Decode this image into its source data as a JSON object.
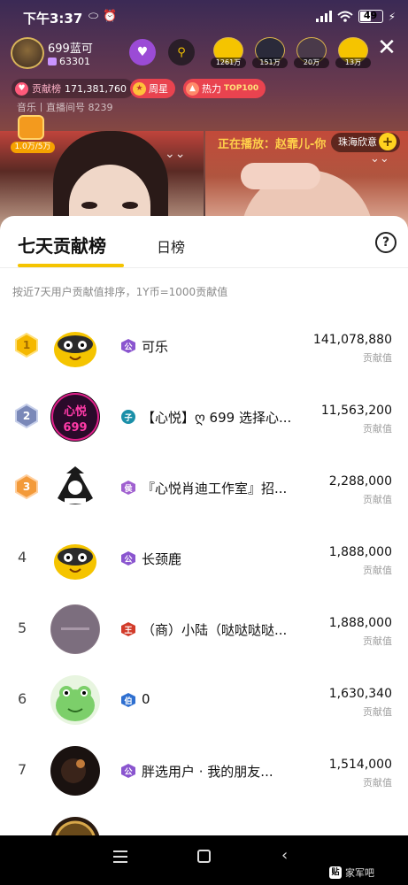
{
  "status_bar": {
    "time": "下午3:37",
    "battery": "49"
  },
  "anchor": {
    "name": "699蓝可",
    "fans": "63301"
  },
  "viewers": [
    "1261万",
    "151万",
    "20万",
    "13万"
  ],
  "contribution": {
    "label": "贡献榜",
    "value": "171,381,760"
  },
  "weekly_star": "周星",
  "hot": {
    "label": "热力",
    "top": "TOP100"
  },
  "room_meta": "音乐丨直播间号  8239",
  "treasure_text": "1.0万/5万",
  "now_playing": "正在播放：赵霏儿-你",
  "pearl_label": "珠海欣意",
  "sheet": {
    "tab_active": "七天贡献榜",
    "tab_day": "日榜",
    "help": "?",
    "description": "按近7天用户贡献值排序，1Y币=1000贡献值",
    "score_unit": "贡献值"
  },
  "ranking": [
    {
      "rank": "1",
      "badge": "公",
      "name": "可乐",
      "score": "141,078,880",
      "badge_color": "#8a55cf",
      "badge_shape": "hex"
    },
    {
      "rank": "2",
      "badge": "子",
      "name": "【心悦】ღ 699 选择心...",
      "score": "11,563,200",
      "badge_color": "#1a8fa8",
      "badge_shape": "circle"
    },
    {
      "rank": "3",
      "badge": "侯",
      "name": "『心悦肖迪工作室』招...",
      "score": "2,288,000",
      "badge_color": "#a060d0",
      "badge_shape": "hex"
    },
    {
      "rank": "4",
      "badge": "公",
      "name": "长颈鹿",
      "score": "1,888,000",
      "badge_color": "#8a55cf",
      "badge_shape": "hex"
    },
    {
      "rank": "5",
      "badge": "王",
      "name": "（商）小陆（哒哒哒哒...",
      "score": "1,888,000",
      "badge_color": "#d23b2a",
      "badge_shape": "hex"
    },
    {
      "rank": "6",
      "badge": "伯",
      "name": "0",
      "score": "1,630,340",
      "badge_color": "#2e6fd0",
      "badge_shape": "hex"
    },
    {
      "rank": "7",
      "badge": "公",
      "name": "胖选用户 · 我的朋友...",
      "score": "1,514,000",
      "badge_color": "#8a55cf",
      "badge_shape": "hex"
    }
  ],
  "watermark": "家军吧",
  "watermark_logo": "贴",
  "colors": {
    "accent_yellow": "#f5c400",
    "gold": "#f5b800",
    "silver": "#7a88b8",
    "bronze": "#f39a3a"
  },
  "icons": [
    "heart-icon",
    "star-icon",
    "flame-icon",
    "help-icon",
    "close-icon",
    "chevron-down-icon",
    "plus-icon",
    "menu-icon",
    "home-icon",
    "back-icon"
  ]
}
